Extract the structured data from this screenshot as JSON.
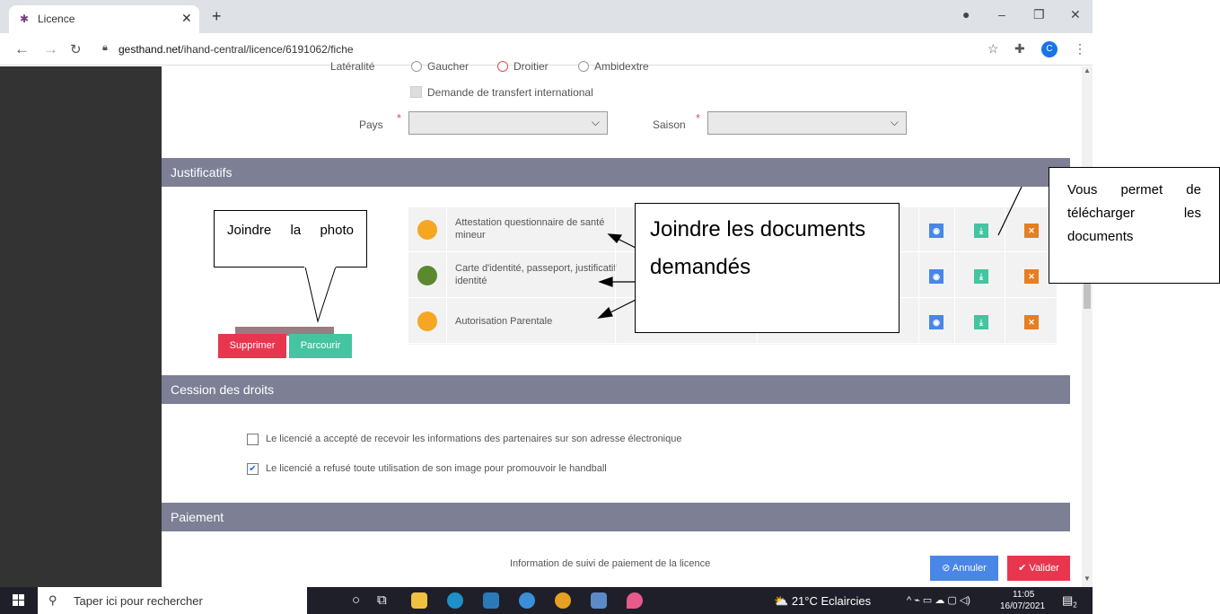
{
  "browser": {
    "tab_title": "Licence",
    "url_domain": "gesthand.net",
    "url_path": "/ihand-central/licence/6191062/fiche",
    "profile_initial": "C"
  },
  "form": {
    "laterality_label": "Latéralité",
    "laterality_options": [
      "Gaucher",
      "Droitier",
      "Ambidextre"
    ],
    "transfer_label": "Demande de transfert international",
    "pays_label": "Pays",
    "saison_label": "Saison"
  },
  "justificatifs": {
    "title": "Justificatifs",
    "delete_button": "Supprimer",
    "browse_button": "Parcourir",
    "documents": [
      {
        "label": "Attestation questionnaire de santé mineur",
        "status_color": "#f5a623"
      },
      {
        "label": "Carte d'identité, passeport, justificatif identité",
        "status_color": "#5b8a2e"
      },
      {
        "label": "Autorisation Parentale",
        "status_color": "#f5a623"
      }
    ]
  },
  "callouts": {
    "photo": "Joindre la photo",
    "documents": "Joindre les documents demandés",
    "download": "Vous permet de télécharger les documents"
  },
  "cession": {
    "title": "Cession des droits",
    "consent_1": "Le licencié a accepté de recevoir les informations des partenaires sur son adresse électronique",
    "consent_2": "Le licencié a refusé toute utilisation de son image pour promouvoir le handball",
    "consent_1_checked": false,
    "consent_2_checked": true
  },
  "paiement": {
    "title": "Paiement",
    "info": "Information de suivi de paiement de la licence",
    "cancel_button": "Annuler",
    "validate_button": "Valider"
  },
  "taskbar": {
    "search_placeholder": "Taper ici pour rechercher",
    "weather": "21°C Eclaircies",
    "time": "11:05",
    "date": "16/07/2021",
    "notif_count": "2"
  }
}
